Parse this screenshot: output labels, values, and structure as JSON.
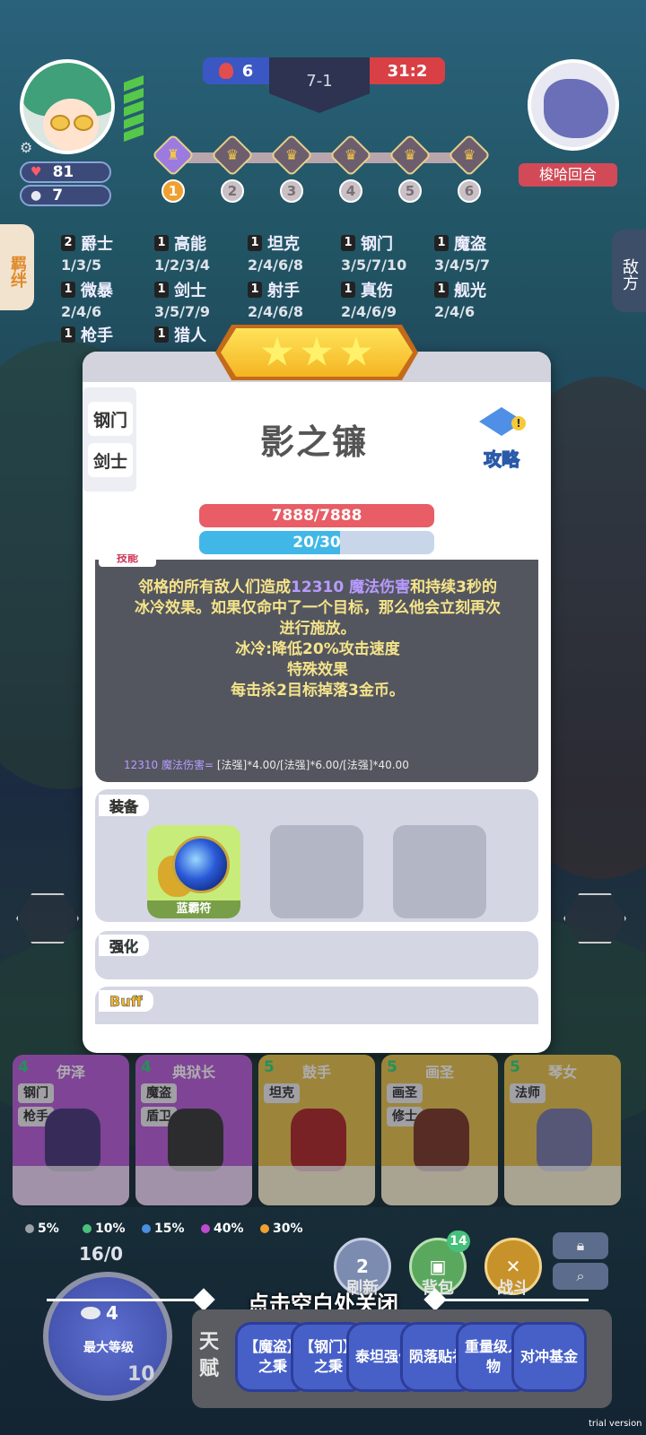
{
  "hud": {
    "health": "81",
    "coins": "7",
    "player_score": "6",
    "round": "7-1",
    "enemy_score": "31:2",
    "opponent_label": "梭哈回合",
    "stages": [
      "1",
      "2",
      "3",
      "4",
      "5",
      "6"
    ]
  },
  "side_tabs": {
    "left": "羁绊",
    "right": "敌方"
  },
  "traits": [
    {
      "count": "2",
      "name": "爵士",
      "levels": "1/3/5"
    },
    {
      "count": "1",
      "name": "高能",
      "levels": "1/2/3/4"
    },
    {
      "count": "1",
      "name": "坦克",
      "levels": "2/4/6/8"
    },
    {
      "count": "1",
      "name": "钢门",
      "levels": "3/5/7/10"
    },
    {
      "count": "1",
      "name": "魔盗",
      "levels": "3/4/5/7"
    },
    {
      "count": "1",
      "name": "微暴",
      "levels": "2/4/6"
    },
    {
      "count": "1",
      "name": "剑士",
      "levels": "3/5/7/9"
    },
    {
      "count": "1",
      "name": "射手",
      "levels": "2/4/6/8"
    },
    {
      "count": "1",
      "name": "真伤",
      "levels": "2/4/6/9"
    },
    {
      "count": "1",
      "name": "舰光",
      "levels": "2/4/6"
    },
    {
      "count": "1",
      "name": "枪手",
      "levels": ""
    },
    {
      "count": "1",
      "name": "猎人",
      "levels": ""
    }
  ],
  "modal": {
    "tags": [
      "钢门",
      "剑士"
    ],
    "hero_name": "影之镰",
    "guide_label": "攻略",
    "hp_text": "7888/7888",
    "mp_text": "20/30",
    "mp_fraction": 0.6,
    "skill_tab": "技能",
    "skill_lines": [
      {
        "pre": "邻格的所有敌人们造成",
        "hl": "12310 魔法伤害",
        "post": "和持续3秒的"
      },
      {
        "pre": "冰冷效果。如果仅命中了一个目标，那么他会立刻再次",
        "hl": "",
        "post": ""
      },
      {
        "pre": "进行施放。",
        "hl": "",
        "post": ""
      },
      {
        "pre": "冰冷:降低20%攻击速度",
        "hl": "",
        "post": ""
      },
      {
        "pre": "特殊效果",
        "hl": "",
        "post": ""
      },
      {
        "pre": "每击杀2目标掉落3金币。",
        "hl": "",
        "post": ""
      }
    ],
    "formula_hl": "12310 魔法伤害=",
    "formula_rest": " [法强]*4.00/[法强]*6.00/[法强]*40.00",
    "equip_label": "装备",
    "equip_item": "蓝霸符",
    "enhance_label": "强化",
    "buff_label": "Buff"
  },
  "bench": [
    {
      "cost": "4",
      "name": "伊泽",
      "tags": [
        "钢门",
        "枪手"
      ],
      "color": "purple"
    },
    {
      "cost": "4",
      "name": "典狱长",
      "tags": [
        "魔盗",
        "盾卫"
      ],
      "color": "purple"
    },
    {
      "cost": "5",
      "name": "鼓手",
      "tags": [
        "坦克"
      ],
      "color": "gold"
    },
    {
      "cost": "5",
      "name": "画圣",
      "tags": [
        "画圣",
        "修士"
      ],
      "color": "gold"
    },
    {
      "cost": "5",
      "name": "琴女",
      "tags": [
        "法师"
      ],
      "color": "gold"
    }
  ],
  "odds": [
    "5%",
    "10%",
    "15%",
    "40%",
    "30%"
  ],
  "odds_colors": [
    "#9aa0a6",
    "#4bc07a",
    "#4a8fe0",
    "#c04ad0",
    "#f0a030"
  ],
  "level": {
    "xp": "16/0",
    "coins": "4",
    "max_label": "最大等级",
    "level_num": "10"
  },
  "buttons": {
    "refresh_cost": "2",
    "refresh": "刷新",
    "bag": "背包",
    "bag_badge": "14",
    "battle": "战斗"
  },
  "close_hint": "点击空白处关闭",
  "talent_label": "天赋",
  "talents": [
    "【魔盗】之秉",
    "【钢门】之秉",
    "泰坦强化",
    "陨落贴礼",
    "重量级人物",
    "对冲基金"
  ],
  "trial": "trial version"
}
